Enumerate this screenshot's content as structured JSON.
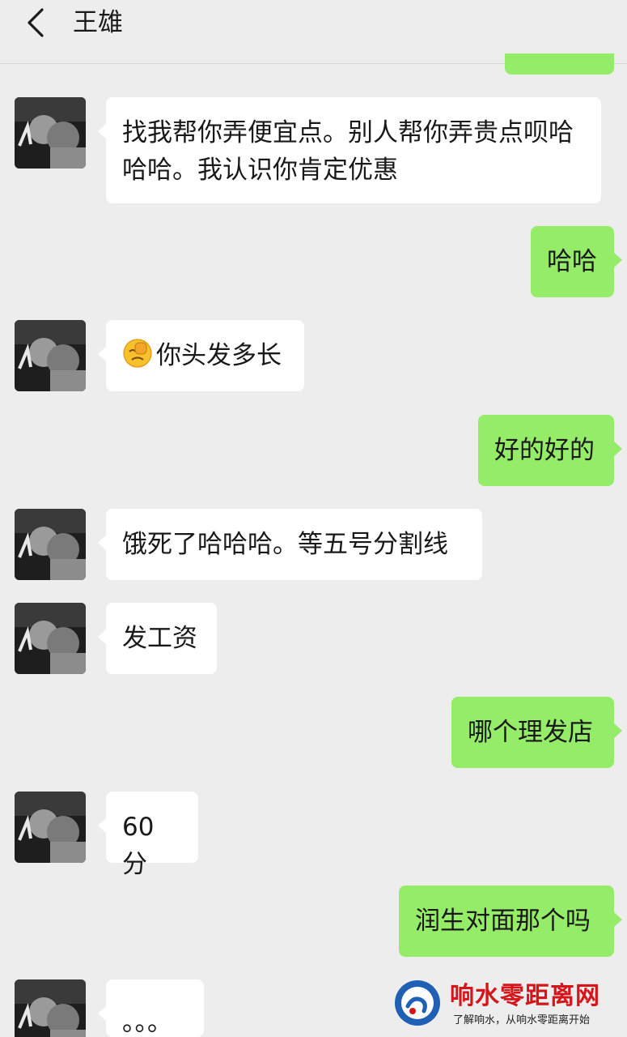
{
  "header": {
    "title": "王雄"
  },
  "messages": [
    {
      "dir": "in",
      "text": "找我帮你弄便宜点。别人帮你弄贵点呗哈哈哈。我认识你肯定优惠"
    },
    {
      "dir": "out",
      "text": "哈哈"
    },
    {
      "dir": "in",
      "text": "你头发多长",
      "emoji": "facepalm-emoji"
    },
    {
      "dir": "out",
      "text": "好的好的"
    },
    {
      "dir": "in",
      "text": "饿死了哈哈哈。等五号分割线"
    },
    {
      "dir": "in",
      "text": "发工资"
    },
    {
      "dir": "out",
      "text": "哪个理发店"
    },
    {
      "dir": "in",
      "text": "60 分"
    },
    {
      "dir": "out",
      "text": "润生对面那个吗"
    },
    {
      "dir": "in",
      "text": "。。。"
    }
  ],
  "watermark": {
    "title": "响水零距离网",
    "subtitle": "了解响水，从响水零距离开始"
  },
  "colors": {
    "background": "#ededed",
    "incoming": "#ffffff",
    "outgoing": "#95ec69",
    "watermark": "#d4161c"
  }
}
